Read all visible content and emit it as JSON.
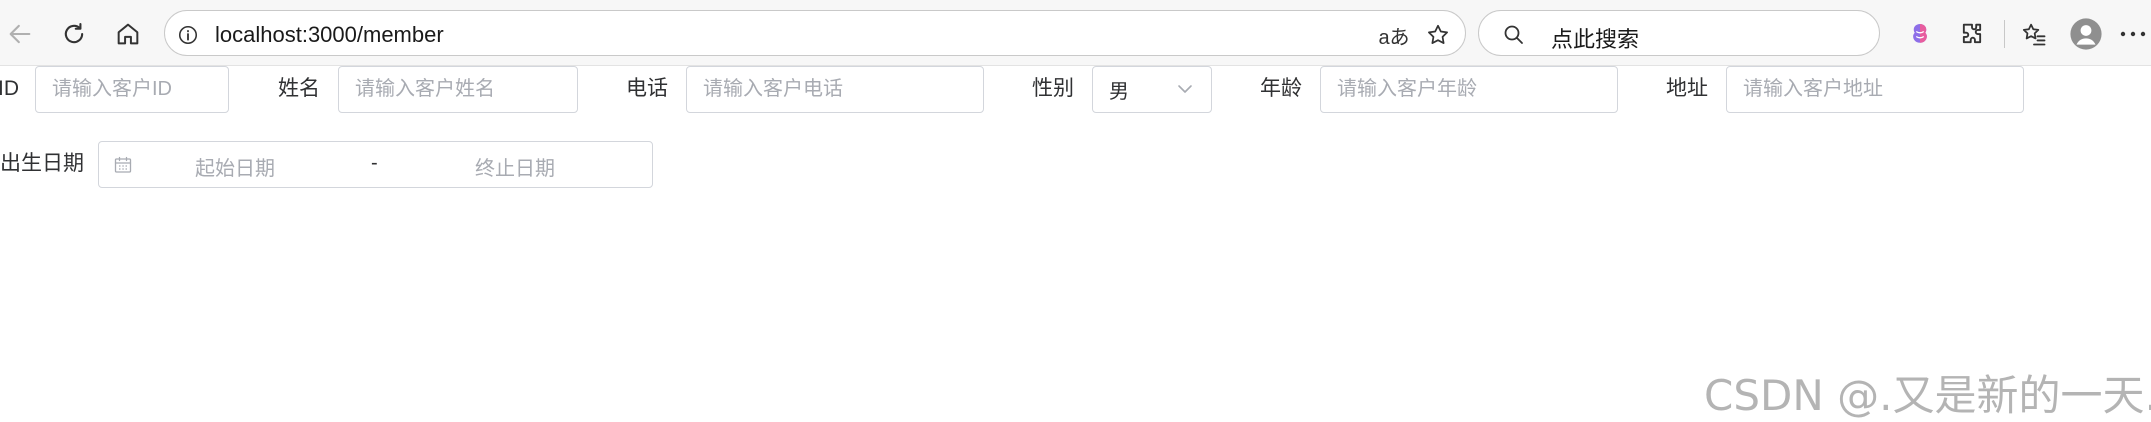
{
  "browser": {
    "url": "localhost:3000/member",
    "search_text": "点此搜索",
    "read_aloud_label": "aあ"
  },
  "form": {
    "id_label": "ID",
    "id_placeholder": "请输入客户ID",
    "name_label": "姓名",
    "name_placeholder": "请输入客户姓名",
    "phone_label": "电话",
    "phone_placeholder": "请输入客户电话",
    "gender_label": "性别",
    "gender_value": "男",
    "age_label": "年龄",
    "age_placeholder": "请输入客户年龄",
    "address_label": "地址",
    "address_placeholder": "请输入客户地址",
    "birthdate_label": "出生日期",
    "start_date_placeholder": "起始日期",
    "date_separator": "-",
    "end_date_placeholder": "终止日期"
  },
  "watermark": "CSDN @.又是新的一天.",
  "icons": [
    "back-arrow-icon",
    "refresh-icon",
    "home-icon",
    "info-icon",
    "read-aloud-icon",
    "favorite-star-icon",
    "search-icon",
    "copilot-icon",
    "extensions-icon",
    "favorites-icon",
    "profile-avatar-icon",
    "more-icon",
    "calendar-icon",
    "chevron-down-icon"
  ]
}
